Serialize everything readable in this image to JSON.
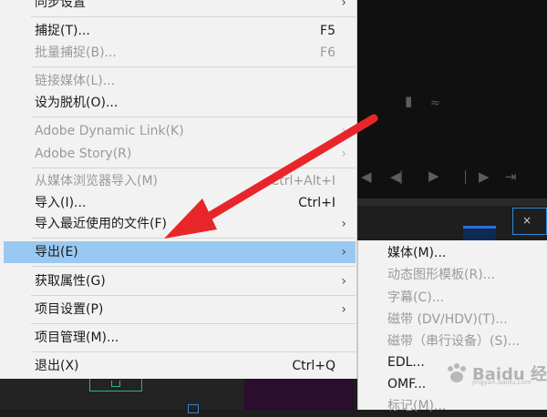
{
  "background": {
    "tab_close": "×",
    "icons": [
      "export-frame-icon",
      "wave-icon",
      "step-back-icon",
      "play-icon",
      "step-forward-icon",
      "go-to-out-icon"
    ]
  },
  "menu": {
    "items": [
      {
        "label": "同步设置",
        "shortcut": "",
        "arrow": true,
        "disabled": false
      },
      {
        "label": "捕捉(T)...",
        "shortcut": "F5",
        "arrow": false,
        "disabled": false
      },
      {
        "label": "批量捕捉(B)...",
        "shortcut": "F6",
        "arrow": false,
        "disabled": true
      },
      {
        "label": "链接媒体(L)...",
        "shortcut": "",
        "arrow": false,
        "disabled": true
      },
      {
        "label": "设为脱机(O)...",
        "shortcut": "",
        "arrow": false,
        "disabled": false
      },
      {
        "label": "Adobe Dynamic Link(K)",
        "shortcut": "",
        "arrow": true,
        "disabled": true
      },
      {
        "label": "Adobe Story(R)",
        "shortcut": "",
        "arrow": true,
        "disabled": true
      },
      {
        "label": "从媒体浏览器导入(M)",
        "shortcut": "Ctrl+Alt+I",
        "arrow": false,
        "disabled": true
      },
      {
        "label": "导入(I)...",
        "shortcut": "Ctrl+I",
        "arrow": false,
        "disabled": false
      },
      {
        "label": "导入最近使用的文件(F)",
        "shortcut": "",
        "arrow": true,
        "disabled": false
      },
      {
        "label": "导出(E)",
        "shortcut": "",
        "arrow": true,
        "disabled": false,
        "highlighted": true
      },
      {
        "label": "获取属性(G)",
        "shortcut": "",
        "arrow": true,
        "disabled": false
      },
      {
        "label": "项目设置(P)",
        "shortcut": "",
        "arrow": true,
        "disabled": false
      },
      {
        "label": "项目管理(M)...",
        "shortcut": "",
        "arrow": false,
        "disabled": false
      },
      {
        "label": "退出(X)",
        "shortcut": "Ctrl+Q",
        "arrow": false,
        "disabled": false
      }
    ]
  },
  "export_submenu": {
    "items": [
      {
        "label": "媒体(M)...",
        "disabled": false
      },
      {
        "label": "动态图形模板(R)...",
        "disabled": true
      },
      {
        "label": "字幕(C)...",
        "disabled": true
      },
      {
        "label": "磁带 (DV/HDV)(T)...",
        "disabled": true
      },
      {
        "label": "磁带（串行设备）(S)...",
        "disabled": true
      },
      {
        "label": "EDL...",
        "disabled": false
      },
      {
        "label": "OMF...",
        "disabled": false
      },
      {
        "label": "标记(M)...",
        "disabled": true
      }
    ]
  },
  "watermark": {
    "brand": "Baidu 经验",
    "url": "jingyan.baidu.com"
  },
  "colors": {
    "highlight": "#99c9f3",
    "arrow": "#e8262a",
    "menu_bg": "#f2f2f2"
  }
}
